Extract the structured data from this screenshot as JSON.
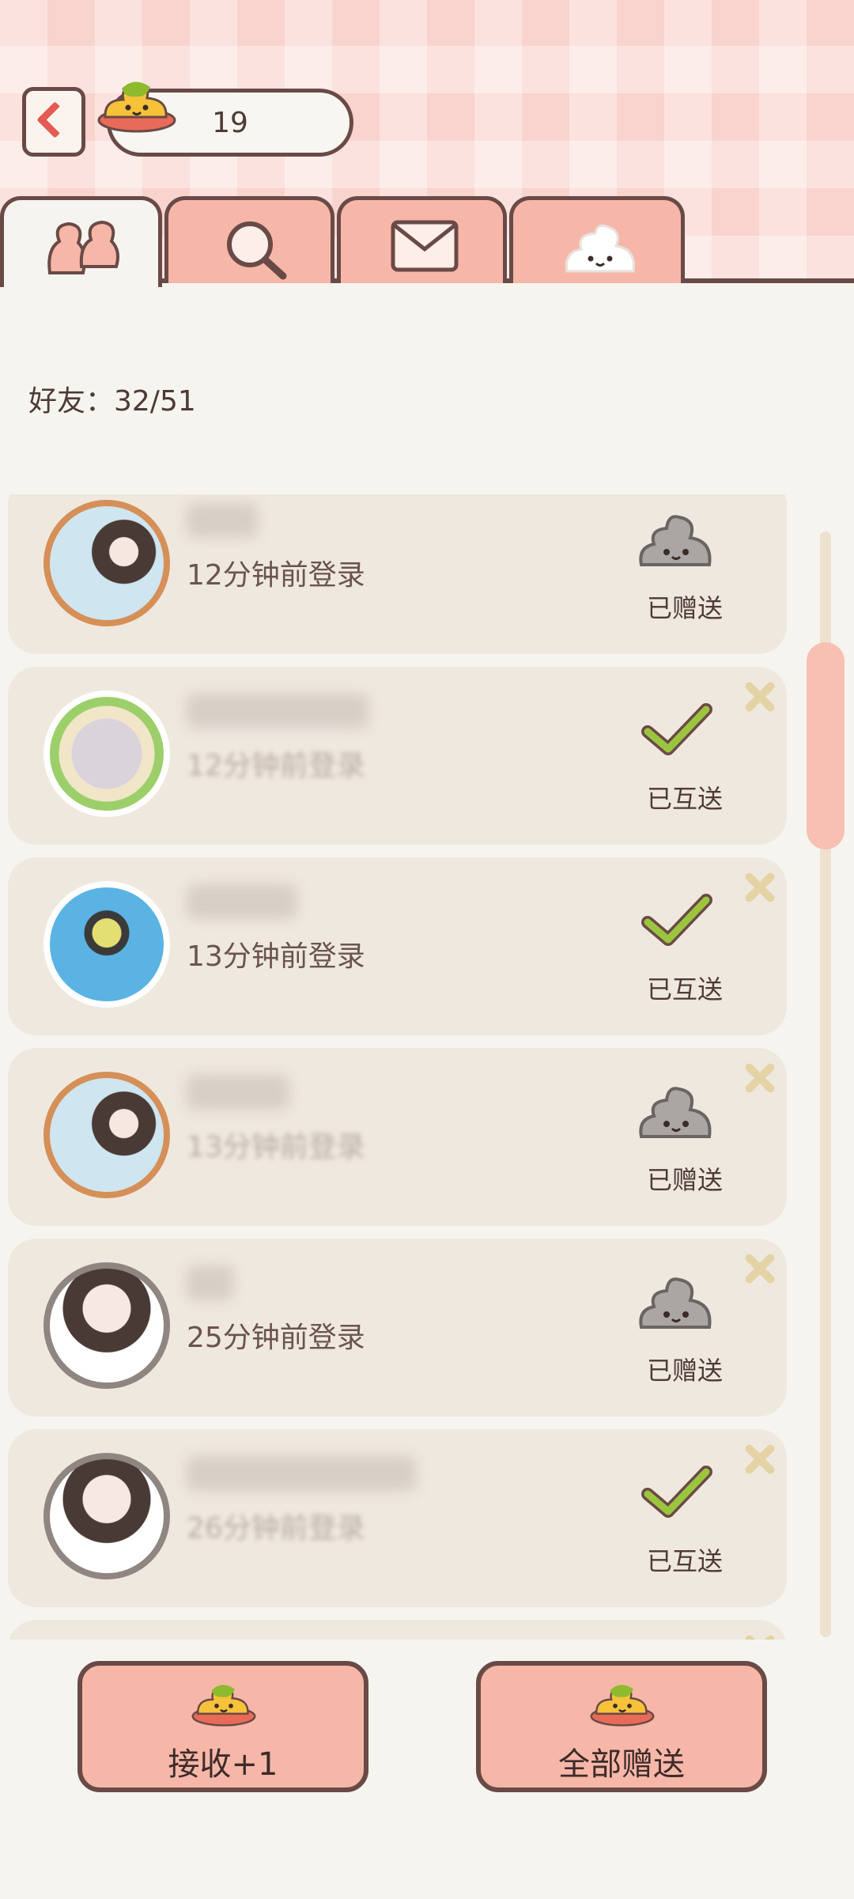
{
  "header": {
    "coin_count": "19",
    "back_icon": "chevron-left-icon",
    "coin_icon": "yellow-poop-coin-icon"
  },
  "tabs": [
    {
      "name": "friends",
      "icon": "friends-icon",
      "active": true
    },
    {
      "name": "search",
      "icon": "search-icon",
      "active": false
    },
    {
      "name": "mail",
      "icon": "mail-icon",
      "active": false
    },
    {
      "name": "poop",
      "icon": "poop-icon",
      "active": false
    }
  ],
  "friends_count": "好友：32/51",
  "friends": [
    {
      "login_time": "12分钟前登录",
      "status": "已赠送",
      "status_icon": "gray-poop-icon"
    },
    {
      "login_time": "12分钟前登录",
      "status": "已互送",
      "status_icon": "check-icon"
    },
    {
      "login_time": "13分钟前登录",
      "status": "已互送",
      "status_icon": "check-icon"
    },
    {
      "login_time": "13分钟前登录",
      "status": "已赠送",
      "status_icon": "gray-poop-icon"
    },
    {
      "login_time": "25分钟前登录",
      "status": "已赠送",
      "status_icon": "gray-poop-icon"
    },
    {
      "login_time": "26分钟前登录",
      "status": "已互送",
      "status_icon": "check-icon"
    }
  ],
  "buttons": {
    "receive_label": "接收+1",
    "give_all_label": "全部赠送"
  },
  "colors": {
    "accent_pink": "#f6b7a9",
    "border_brown": "#6a4a46",
    "check_green": "#8cb83e",
    "card_bg": "#efe8df"
  }
}
